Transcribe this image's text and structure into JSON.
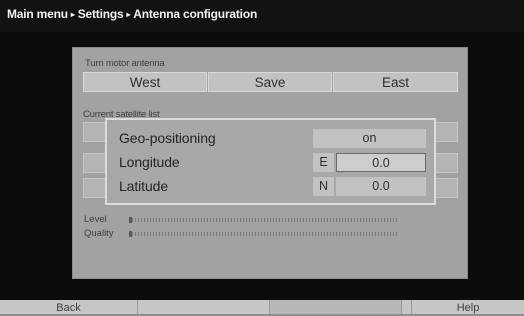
{
  "breadcrumb": {
    "items": [
      "Main menu",
      "Settings",
      "Antenna configuration"
    ],
    "separator": "▸"
  },
  "turn_motor": {
    "label": "Turn motor antenna",
    "buttons": [
      "West",
      "Save",
      "East"
    ]
  },
  "satellite_list": {
    "label": "Current satellite list"
  },
  "geo_dialog": {
    "rows": [
      {
        "label": "Geo-positioning",
        "value": "on"
      },
      {
        "label": "Longitude",
        "direction": "E",
        "value": "0.0"
      },
      {
        "label": "Latitude",
        "direction": "N",
        "value": "0.0"
      }
    ]
  },
  "meters": {
    "level": {
      "label": "Level",
      "value_fraction": 0.01
    },
    "quality": {
      "label": "Quality",
      "value_fraction": 0.01
    }
  },
  "softkeys": [
    "Back",
    "",
    "",
    "",
    "Help"
  ],
  "colors": {
    "screen_bg": "#0c0c0c",
    "panel_bg": "#a2a2a2",
    "button_bg": "#c2c2c2",
    "softkey_bg": "#c6c6c6"
  }
}
